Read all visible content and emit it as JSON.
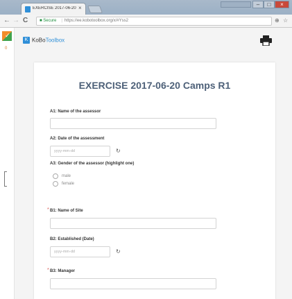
{
  "browser": {
    "tab_title": "EXERCISE 2017-06-20 Ca",
    "tab_close": "×",
    "back": "←",
    "forward": "→",
    "reload": "C",
    "secure_label": "Secure",
    "url": "https://ee.kobotoolbox.org/x/#Yss2"
  },
  "app": {
    "counter": "0",
    "logo_kobo": "KoBo",
    "logo_toolbox": "Toolbox"
  },
  "form": {
    "title": "EXERCISE 2017-06-20 Camps R1",
    "questions": {
      "a1": {
        "label": "A1: Name of the assessor",
        "value": ""
      },
      "a2": {
        "label": "A2: Date of the assessment",
        "placeholder": "yyyy-mm-dd",
        "reset_icon": "refresh-icon"
      },
      "a3": {
        "label": "A3: Gender of the assessor (highlight one)",
        "options": [
          "male",
          "female"
        ]
      },
      "b1": {
        "label": "B1: Name of Site",
        "required_mark": "*",
        "value": ""
      },
      "b2": {
        "label": "B2: Established (Date)",
        "placeholder": "yyyy-mm-dd",
        "reset_icon": "refresh-icon"
      },
      "b3": {
        "label": "B3: Manager",
        "required_mark": "*",
        "value": ""
      }
    }
  },
  "colors": {
    "title": "#4d6078",
    "accent": "#2f8fd8",
    "required": "#d9534f"
  }
}
